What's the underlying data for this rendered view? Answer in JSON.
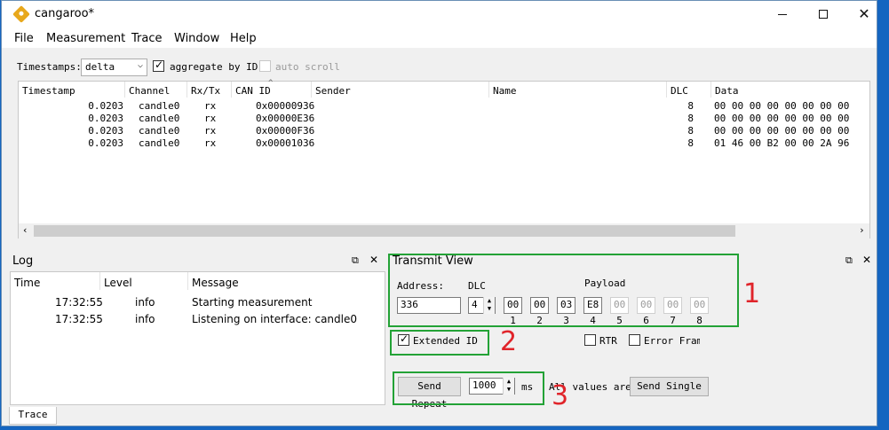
{
  "window": {
    "title": "cangaroo*"
  },
  "menu": [
    "File",
    "Measurement",
    "Trace",
    "Window",
    "Help"
  ],
  "toolbar": {
    "timestamps_label": "Timestamps:",
    "timestamps_value": "delta",
    "aggregate_label": "aggregate by ID",
    "aggregate_checked": true,
    "autoscroll_label": "auto scroll",
    "autoscroll_checked": false
  },
  "trace": {
    "columns": [
      "Timestamp",
      "Channel",
      "Rx/Tx",
      "CAN ID",
      "Sender",
      "Name",
      "DLC",
      "Data"
    ],
    "rows": [
      {
        "timestamp": "0.0203",
        "channel": "candle0",
        "rxtx": "rx",
        "can_id": "0x00000936",
        "sender": "",
        "name": "",
        "dlc": "8",
        "data": "00 00 00 00 00 00 00 00"
      },
      {
        "timestamp": "0.0203",
        "channel": "candle0",
        "rxtx": "rx",
        "can_id": "0x00000E36",
        "sender": "",
        "name": "",
        "dlc": "8",
        "data": "00 00 00 00 00 00 00 00"
      },
      {
        "timestamp": "0.0203",
        "channel": "candle0",
        "rxtx": "rx",
        "can_id": "0x00000F36",
        "sender": "",
        "name": "",
        "dlc": "8",
        "data": "00 00 00 00 00 00 00 00"
      },
      {
        "timestamp": "0.0203",
        "channel": "candle0",
        "rxtx": "rx",
        "can_id": "0x00001036",
        "sender": "",
        "name": "",
        "dlc": "8",
        "data": "01 46 00 B2 00 00 2A 96"
      }
    ]
  },
  "log": {
    "title": "Log",
    "columns": [
      "Time",
      "Level",
      "Message"
    ],
    "rows": [
      {
        "time": "17:32:55",
        "level": "info",
        "message": "Starting measurement"
      },
      {
        "time": "17:32:55",
        "level": "info",
        "message": "Listening on interface: candle0"
      }
    ]
  },
  "transmit": {
    "title": "Transmit View",
    "address_label": "Address:",
    "address_value": "336",
    "dlc_label": "DLC",
    "dlc_value": "4",
    "payload_label": "Payload",
    "payload": [
      "00",
      "00",
      "03",
      "E8",
      "00",
      "00",
      "00",
      "00"
    ],
    "payload_indices": [
      "1",
      "2",
      "3",
      "4",
      "5",
      "6",
      "7",
      "8"
    ],
    "extended_id_label": "Extended ID",
    "extended_id_checked": true,
    "rtr_label": "RTR",
    "error_frame_label": "Error Frame",
    "send_repeat_label": "Send Repeat",
    "interval_value": "1000",
    "interval_unit": "ms",
    "all_values_text": "All values are i",
    "send_single_label": "Send Single"
  },
  "annotations": [
    "1",
    "2",
    "3"
  ],
  "tabs": {
    "trace": "Trace"
  },
  "colors": {
    "annotation_box": "#23a236",
    "annotation_number": "#e0242a",
    "desktop": "#1565c0"
  }
}
